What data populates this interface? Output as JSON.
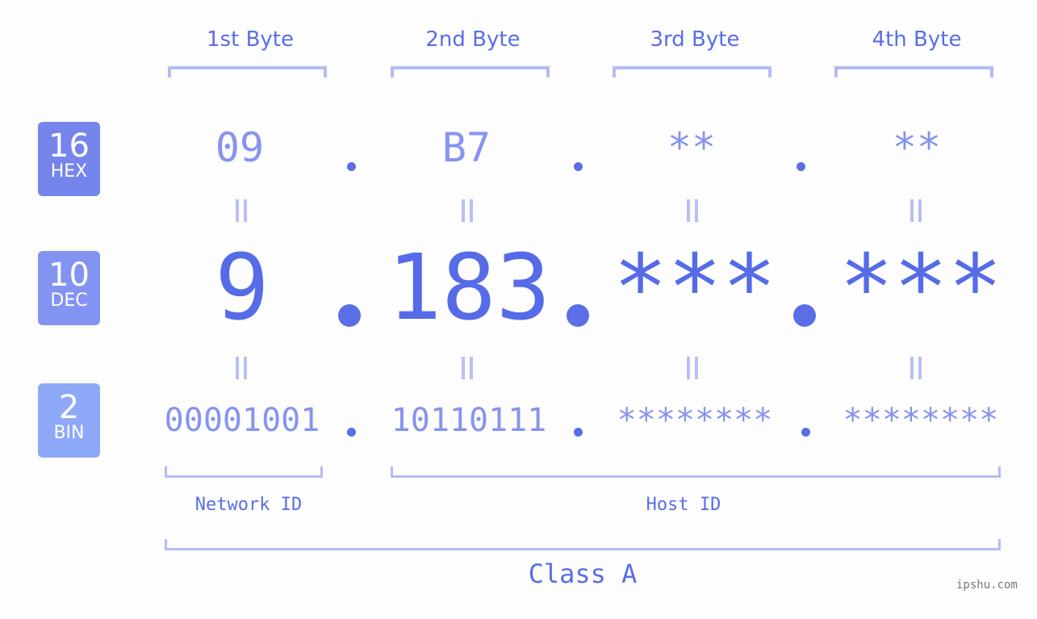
{
  "bytes": {
    "labels": [
      "1st Byte",
      "2nd Byte",
      "3rd Byte",
      "4th Byte"
    ]
  },
  "badges": {
    "hex": {
      "num": "16",
      "label": "HEX",
      "color": "#7585ec"
    },
    "dec": {
      "num": "10",
      "label": "DEC",
      "color": "#8393f1"
    },
    "bin": {
      "num": "2",
      "label": "BIN",
      "color": "#8ea8f8"
    }
  },
  "values": {
    "hex": [
      "09",
      "B7",
      "**",
      "**"
    ],
    "dec": [
      "9",
      "183",
      "***",
      "***"
    ],
    "bin": [
      "00001001",
      "10110111",
      "********",
      "********"
    ]
  },
  "segments": {
    "network": "Network ID",
    "host": "Host ID",
    "class": "Class A"
  },
  "watermark": "ipshu.com",
  "colors": {
    "accent": "#566be8",
    "light": "#8793ef",
    "bracket": "#b3bcf5"
  }
}
